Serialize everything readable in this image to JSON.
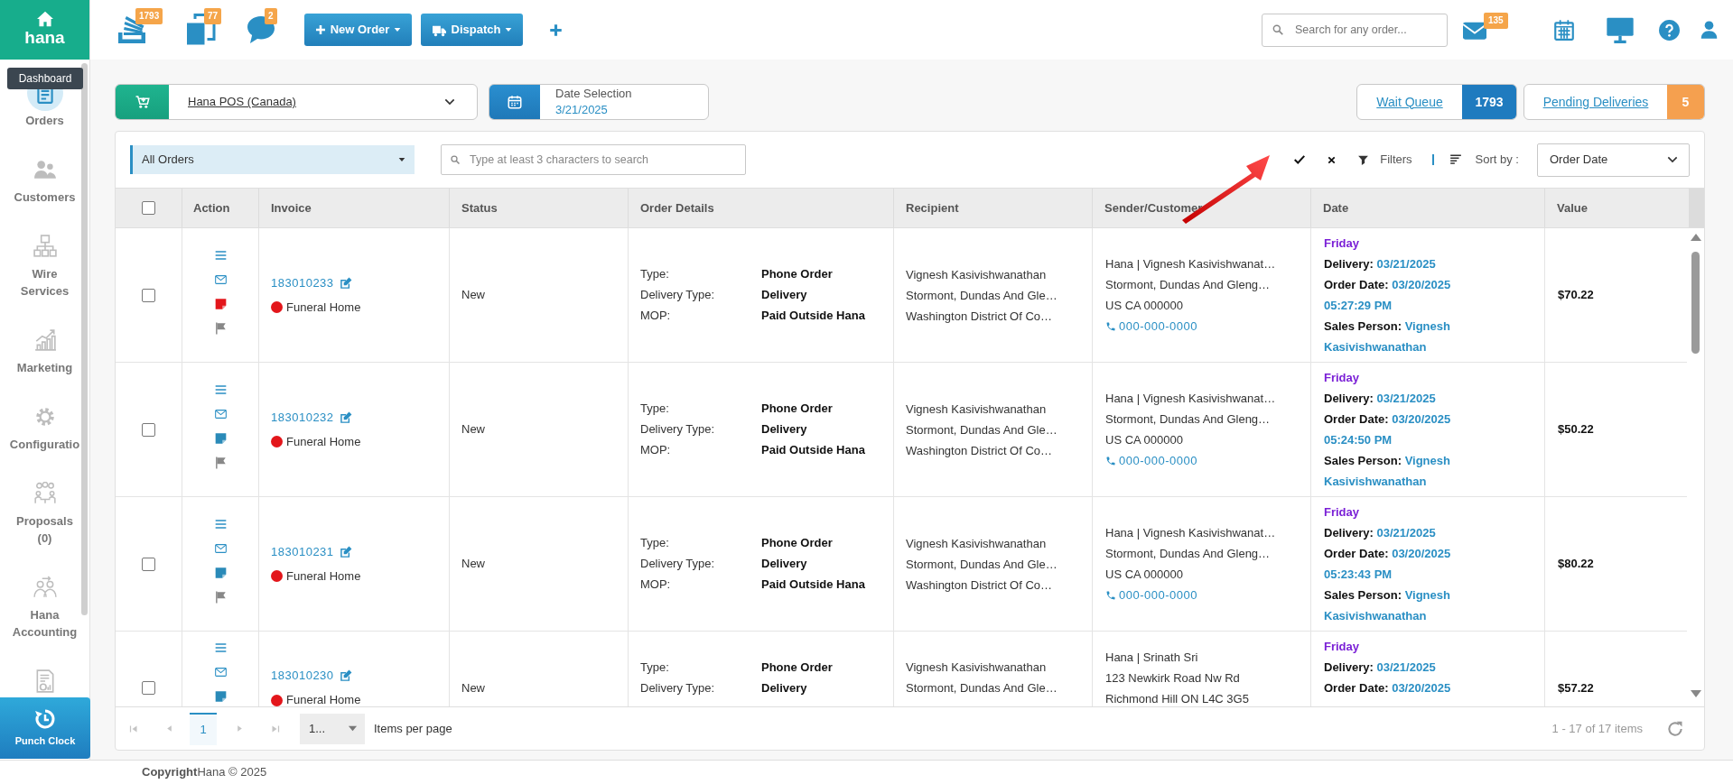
{
  "app": {
    "logo": "hana",
    "tooltip": "Dashboard"
  },
  "toolbar": {
    "counters": [
      {
        "kind": "stack",
        "count": "1793"
      },
      {
        "kind": "copy",
        "count": "77"
      },
      {
        "kind": "chat",
        "count": "2"
      }
    ],
    "buttons": [
      {
        "kind": "new",
        "label": "New Order"
      },
      {
        "kind": "truck",
        "label": "Dispatch"
      }
    ],
    "search_placeholder": "Search for any order...",
    "mail_count": "135"
  },
  "sidebar": {
    "items": [
      {
        "kind": "orders",
        "label": "Orders",
        "selected": true
      },
      {
        "kind": "customers",
        "label": "Customers",
        "selected": false
      },
      {
        "kind": "wire",
        "label": "Wire Services",
        "selected": false
      },
      {
        "kind": "marketing",
        "label": "Marketing",
        "selected": false
      },
      {
        "kind": "configuration",
        "label": "Configuratio",
        "selected": false
      },
      {
        "kind": "proposals",
        "label": "Proposals (0)",
        "selected": false
      },
      {
        "kind": "accounting",
        "label": "Hana Accounting",
        "selected": false
      },
      {
        "kind": "reports",
        "selected": false
      }
    ],
    "punch_clock": "Punch Clock"
  },
  "selectors": {
    "store": "Hana POS (Canada)",
    "date_label": "Date Selection",
    "date": "3/21/2025",
    "queues": [
      {
        "label": "Wait Queue",
        "count": "1793",
        "color": "#1f7bbf"
      },
      {
        "label": "Pending Deliveries",
        "count": "5",
        "color": "#f5a04f"
      }
    ]
  },
  "filters": {
    "view": "All Orders",
    "search_placeholder": "Type at least 3 characters to search",
    "filters_label": "Filters",
    "sort_label": "Sort by :",
    "sort_value": "Order Date"
  },
  "table": {
    "select_all": {
      "checked": false
    },
    "columns": [
      "Action",
      "Invoice",
      "Status",
      "Order Details",
      "Recipient",
      "Sender/Customer",
      "Date",
      "Value"
    ],
    "rows": [
      {
        "checked": false,
        "icons": [
          {
            "kind": "menu"
          },
          {
            "kind": "mail"
          },
          {
            "kind": "note",
            "color": "#e3161b"
          },
          {
            "kind": "flag"
          }
        ],
        "invoice": "183010233",
        "category": "Funeral Home",
        "status": "New",
        "details": [
          {
            "label": "Type:",
            "value": "Phone Order"
          },
          {
            "label": "Delivery Type:",
            "value": "Delivery"
          },
          {
            "label": "MOP:",
            "value": "Paid Outside Hana"
          }
        ],
        "recipient": [
          "Vignesh Kasivishwanathan",
          "Stormont, Dundas And Gle…",
          "Washington District Of Co…"
        ],
        "sender": [
          "Hana | Vignesh Kasivishwanat…",
          "Stormont, Dundas And Gleng…",
          "US CA 000000"
        ],
        "phone": "000-000-0000",
        "date": {
          "day": "Friday",
          "delivery_label": "Delivery:",
          "delivery": "03/21/2025",
          "order_label": "Order Date:",
          "order_date": "03/20/2025",
          "order_time": "05:27:29 PM",
          "sales_label": "Sales Person:",
          "sales_person": "Vignesh Kasivishwanathan"
        },
        "value": "$70.22"
      },
      {
        "checked": false,
        "icons": [
          {
            "kind": "menu"
          },
          {
            "kind": "mail"
          },
          {
            "kind": "note",
            "color": "#2a8ab8"
          },
          {
            "kind": "flag"
          }
        ],
        "invoice": "183010232",
        "category": "Funeral Home",
        "status": "New",
        "details": [
          {
            "label": "Type:",
            "value": "Phone Order"
          },
          {
            "label": "Delivery Type:",
            "value": "Delivery"
          },
          {
            "label": "MOP:",
            "value": "Paid Outside Hana"
          }
        ],
        "recipient": [
          "Vignesh Kasivishwanathan",
          "Stormont, Dundas And Gle…",
          "Washington District Of Co…"
        ],
        "sender": [
          "Hana | Vignesh Kasivishwanat…",
          "Stormont, Dundas And Gleng…",
          "US CA 000000"
        ],
        "phone": "000-000-0000",
        "date": {
          "day": "Friday",
          "delivery_label": "Delivery:",
          "delivery": "03/21/2025",
          "order_label": "Order Date:",
          "order_date": "03/20/2025",
          "order_time": "05:24:50 PM",
          "sales_label": "Sales Person:",
          "sales_person": "Vignesh Kasivishwanathan"
        },
        "value": "$50.22"
      },
      {
        "checked": false,
        "icons": [
          {
            "kind": "menu"
          },
          {
            "kind": "mail"
          },
          {
            "kind": "note",
            "color": "#2a8ab8"
          },
          {
            "kind": "flag"
          }
        ],
        "invoice": "183010231",
        "category": "Funeral Home",
        "status": "New",
        "details": [
          {
            "label": "Type:",
            "value": "Phone Order"
          },
          {
            "label": "Delivery Type:",
            "value": "Delivery"
          },
          {
            "label": "MOP:",
            "value": "Paid Outside Hana"
          }
        ],
        "recipient": [
          "Vignesh Kasivishwanathan",
          "Stormont, Dundas And Gle…",
          "Washington District Of Co…"
        ],
        "sender": [
          "Hana | Vignesh Kasivishwanat…",
          "Stormont, Dundas And Gleng…",
          "US CA 000000"
        ],
        "phone": "000-000-0000",
        "date": {
          "day": "Friday",
          "delivery_label": "Delivery:",
          "delivery": "03/21/2025",
          "order_label": "Order Date:",
          "order_date": "03/20/2025",
          "order_time": "05:23:43 PM",
          "sales_label": "Sales Person:",
          "sales_person": "Vignesh Kasivishwanathan"
        },
        "value": "$80.22"
      },
      {
        "checked": false,
        "icons": [
          {
            "kind": "menu"
          },
          {
            "kind": "mail"
          },
          {
            "kind": "note",
            "color": "#2a8ab8"
          }
        ],
        "invoice": "183010230",
        "category": "Funeral Home",
        "status": "New",
        "details": [
          {
            "label": "Type:",
            "value": "Phone Order"
          },
          {
            "label": "Delivery Type:",
            "value": "Delivery"
          }
        ],
        "recipient": [
          "Vignesh Kasivishwanathan",
          "Stormont, Dundas And Gle…"
        ],
        "sender": [
          "Hana | Srinath Sri",
          "123 Newkirk Road Nw Rd",
          "Richmond Hill ON L4C 3G5"
        ],
        "date": {
          "day": "Friday",
          "delivery_label": "Delivery:",
          "delivery": "03/21/2025",
          "order_label": "Order Date:",
          "order_date": "03/20/2025"
        },
        "value": "$57.22"
      }
    ]
  },
  "pagination": {
    "pages": [
      {
        "label": "1",
        "selected": true
      }
    ],
    "page_size": "1...",
    "page_size_label": "Items per page",
    "summary": "1 - 17 of 17 items"
  },
  "footer": "**Copyright**Hana © 2025"
}
